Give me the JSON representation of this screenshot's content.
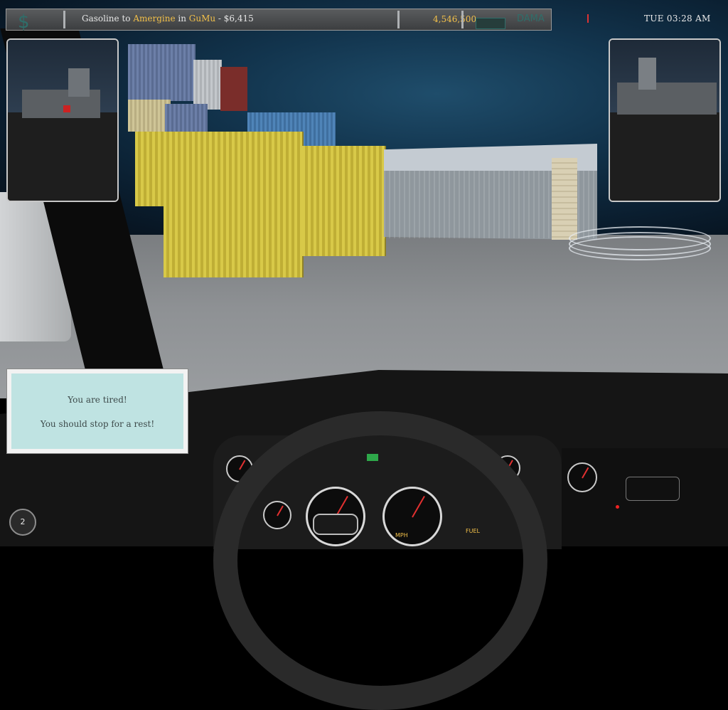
{
  "hud": {
    "currency_symbol": "$",
    "job_prefix": "Gasoline to ",
    "destination": "Amergine",
    "job_in": " in ",
    "city": "GuMu",
    "payment": " - $6,415",
    "money": "4,546,500",
    "damage_label": "DAMA",
    "clock": "TUE 03:28 AM"
  },
  "message": {
    "line1": "You are tired!",
    "line2": "You should stop for a rest!"
  },
  "badge": {
    "value": "2"
  },
  "dash": {
    "speed_unit": "MPH",
    "fuel_label": "FUEL"
  },
  "colors": {
    "hud_highlight": "#f2c04a",
    "message_bg": "#bfe3e2",
    "needle": "#e23030"
  }
}
